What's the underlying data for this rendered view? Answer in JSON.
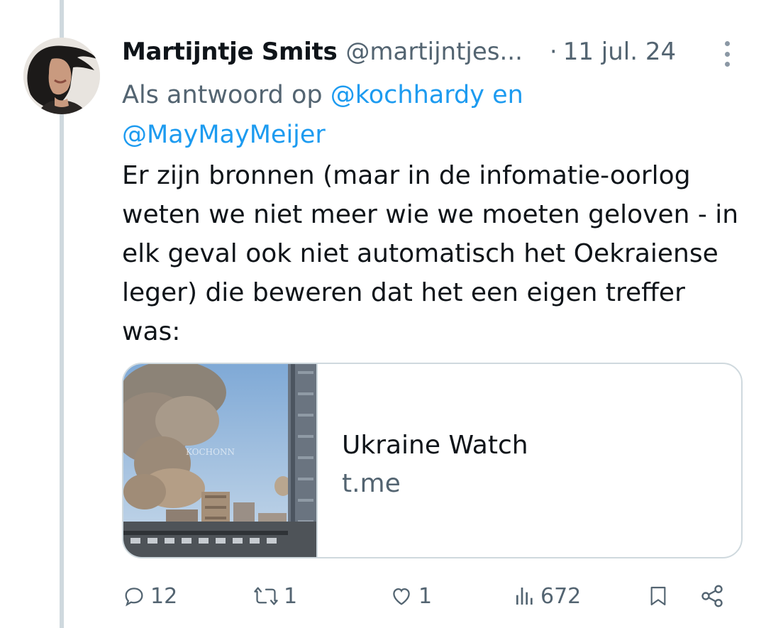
{
  "tweet": {
    "display_name": "Martijntje Smits",
    "handle": "@martijntjes...",
    "dot": "·",
    "date": "11 jul. 24",
    "reply_prefix": "Als antwoord op",
    "reply_mention_1": "@kochhardy",
    "reply_connector": "en",
    "reply_mention_2": "@MayMayMeijer",
    "text": "Er zijn bronnen (maar in de infomatie-oorlog weten we niet meer wie we moeten geloven - in elk geval ook niet automatisch het Oekraiense leger) die beweren dat het een eigen treffer was:"
  },
  "card": {
    "title": "Ukraine Watch",
    "domain": "t.me",
    "thumbnail_watermark": "KOCHONN"
  },
  "actions": {
    "replies": "12",
    "reposts": "1",
    "likes": "1",
    "views": "672"
  },
  "colors": {
    "text_primary": "#0f1419",
    "text_secondary": "#536471",
    "link": "#1d9bf0",
    "border": "#cfd9de"
  },
  "icons": [
    "more-vertical-icon",
    "reply-icon",
    "repost-icon",
    "like-icon",
    "views-icon",
    "bookmark-icon",
    "share-icon"
  ]
}
